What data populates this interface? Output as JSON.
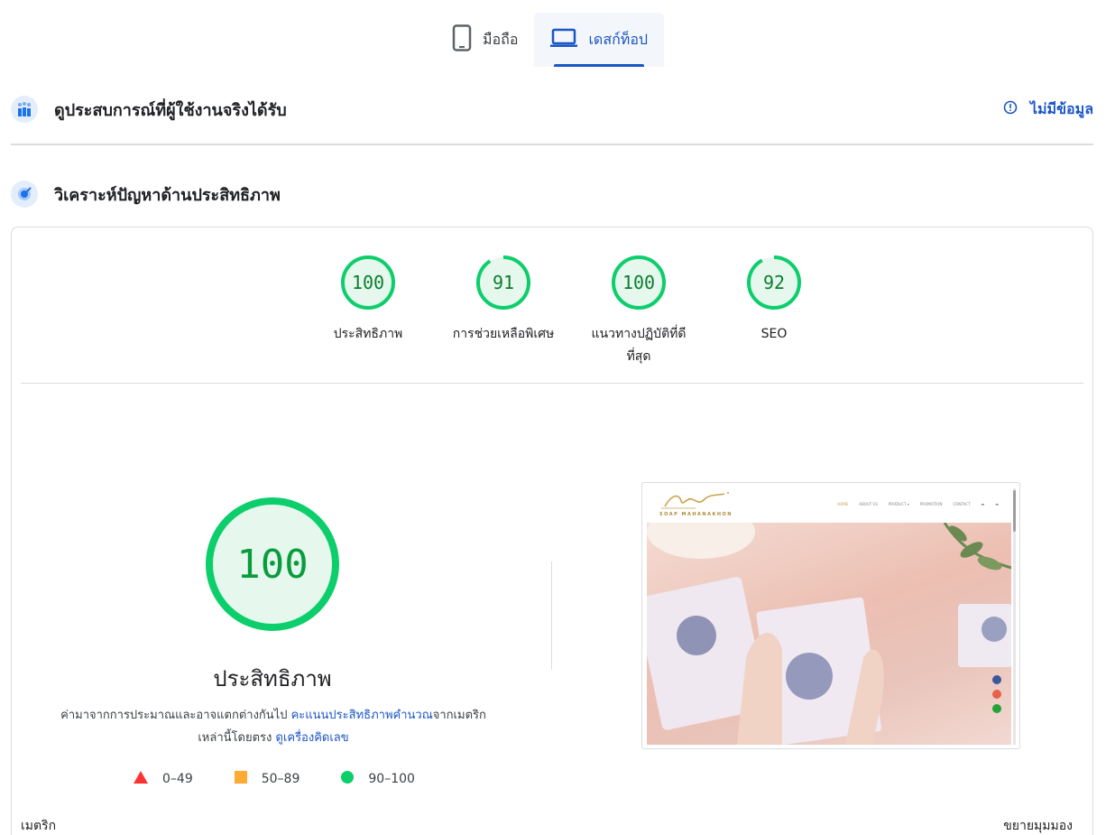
{
  "tabs": [
    {
      "label": "มือถือ",
      "icon": "smartphone-icon",
      "active": false
    },
    {
      "label": "เดสก์ท็อป",
      "icon": "laptop-icon",
      "active": true
    }
  ],
  "field_data": {
    "title": "ดูประสบการณ์ที่ผู้ใช้งานจริงได้รับ",
    "status": "ไม่มีข้อมูล",
    "icon": "field-data-icon"
  },
  "diagnose": {
    "title": "วิเคราะห์ปัญหาด้านประสิทธิภาพ",
    "icon": "lab-data-icon"
  },
  "categories": [
    {
      "score": "100",
      "label": "ประสิทธิภาพ",
      "fraction": 1.0
    },
    {
      "score": "91",
      "label": "การช่วยเหลือพิเศษ",
      "fraction": 0.91
    },
    {
      "score": "100",
      "label": "แนวทางปฏิบัติที่ดีที่สุด",
      "fraction": 1.0
    },
    {
      "score": "92",
      "label": "SEO",
      "fraction": 0.92
    }
  ],
  "main_gauge": {
    "score": "100",
    "title": "ประสิทธิภาพ",
    "fraction": 1.0
  },
  "description": {
    "text1": "ค่ามาจากการประมาณและอาจแตกต่างกันไป ",
    "link1": "คะแนนประสิทธิภาพคำนวณ",
    "text2": "จากเมตริกเหล่านี้โดยตรง ",
    "link2": "ดูเครื่องคิดเลข"
  },
  "legend": [
    {
      "range": "0–49",
      "shape": "triangle",
      "color": "#ff3333"
    },
    {
      "range": "50–89",
      "shape": "square",
      "color": "#ffaa33"
    },
    {
      "range": "90–100",
      "shape": "circle",
      "color": "#0cce6b"
    }
  ],
  "screenshot": {
    "brand": "SOAP MAHANAKHON",
    "menu": [
      "HOME",
      "ABOUT US",
      "PRODUCT ▾",
      "PROMOTION",
      "CONTACT"
    ]
  },
  "footer": {
    "metrics_label": "เมตริก",
    "expand_label": "ขยายมุมมอง"
  },
  "colors": {
    "pass_green": "#0cce6b",
    "pass_fill": "#e6f8ee",
    "accent_blue": "#1a56c7"
  }
}
